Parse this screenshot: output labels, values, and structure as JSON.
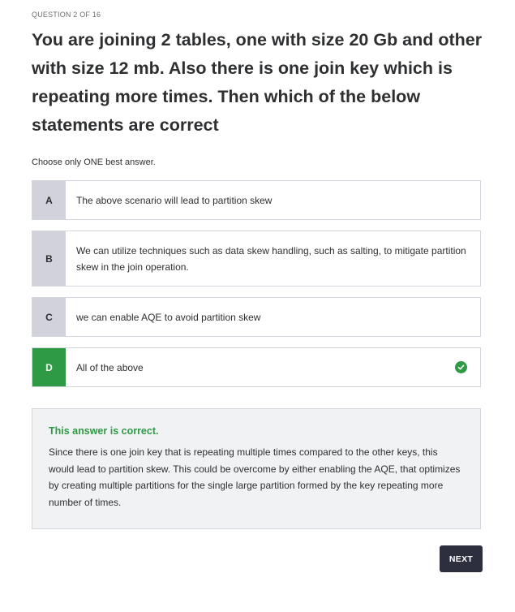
{
  "progress": "QUESTION 2 OF 16",
  "question": "You are joining 2 tables, one with size 20 Gb and other with size 12 mb. Also there is one join key which is repeating more times. Then which of the below statements are correct",
  "instruction": "Choose only ONE best answer.",
  "options": [
    {
      "letter": "A",
      "text": "The above scenario will lead to partition skew"
    },
    {
      "letter": "B",
      "text": "We can utilize techniques such as data skew handling, such as salting, to mitigate partition skew in the join operation."
    },
    {
      "letter": "C",
      "text": "we can enable AQE to avoid partition skew"
    },
    {
      "letter": "D",
      "text": "All of the above"
    }
  ],
  "selected_option": "D",
  "feedback": {
    "status": "This answer is correct.",
    "explanation": "Since there is one join key that is repeating multiple times compared to the other keys, this would lead to partition skew. This could be overcome by either enabling the AQE, that optimizes by creating multiple partitions for the single large partition formed by the key repeating more number of times."
  },
  "next_button": "NEXT",
  "icons": {
    "correct": "check-circle-icon"
  },
  "colors": {
    "correct_green": "#2e9a45",
    "letter_bg": "#d1d2db",
    "next_button_bg": "#2d2f3e"
  }
}
